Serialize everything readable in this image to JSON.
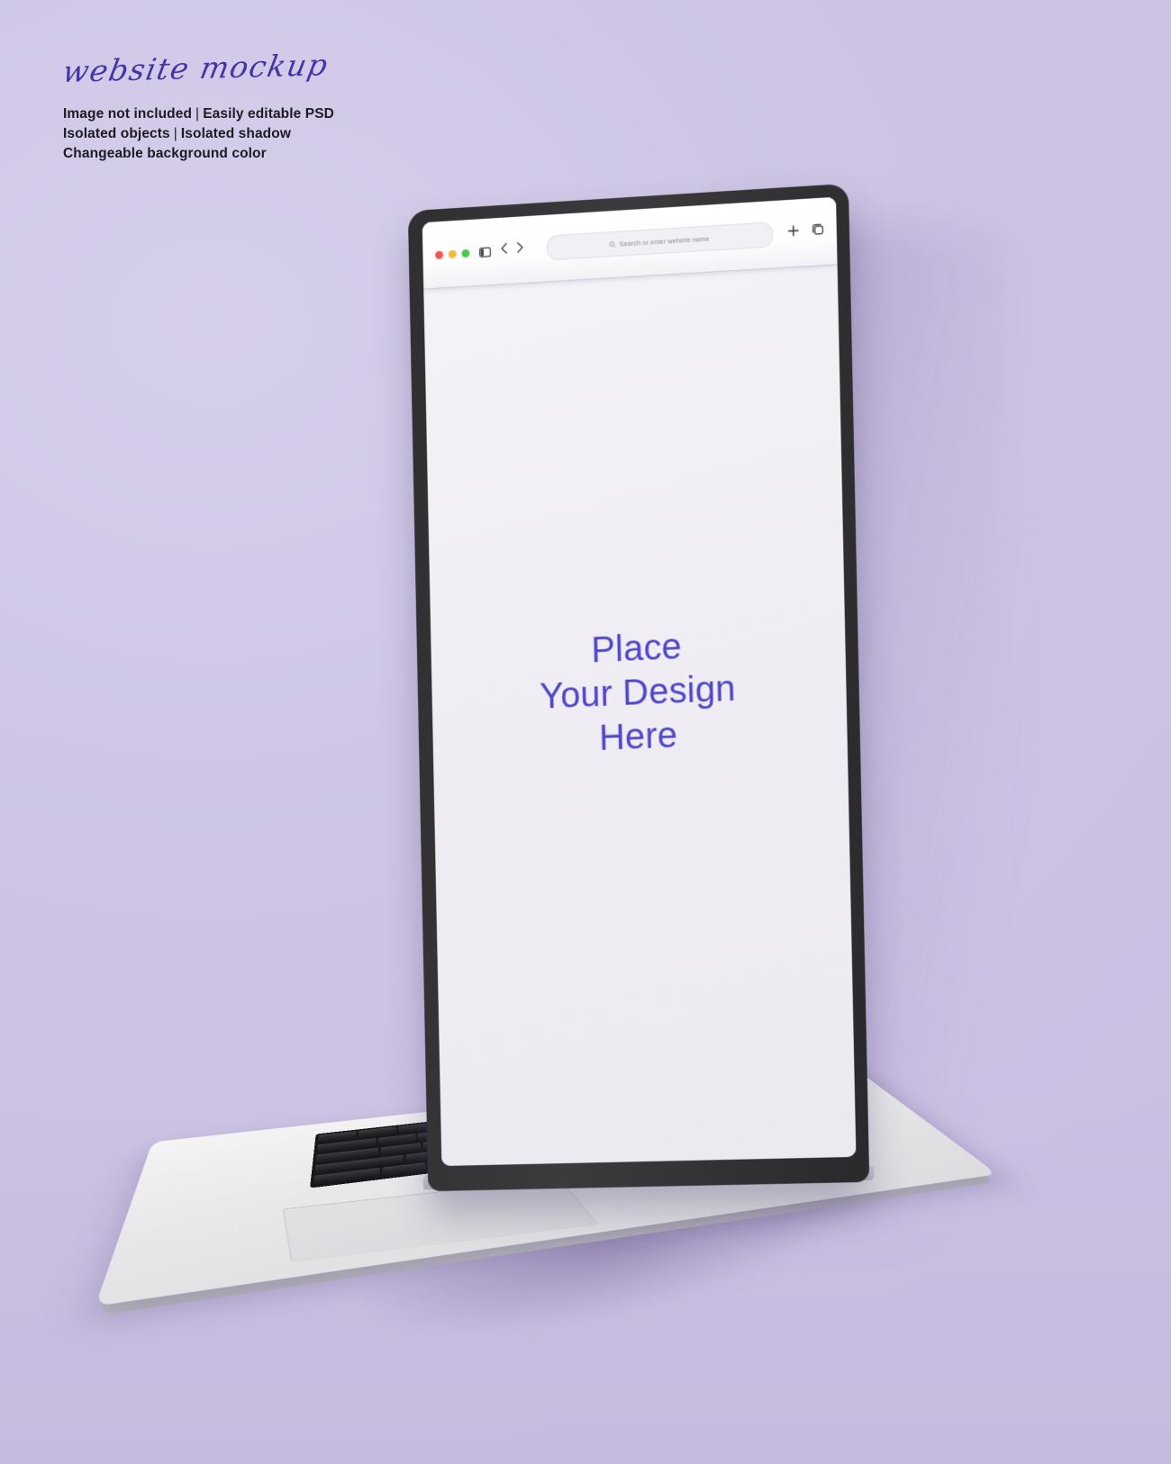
{
  "background": {
    "color": "#cfc6e6",
    "accent_text_color": "#4335a8",
    "design_text_color": "#4f46c8"
  },
  "caption": {
    "script_title": "website mockup",
    "line1_a": "Image not included",
    "line1_b": "Easily editable PSD",
    "line2_a": "Isolated objects",
    "line2_b": "Isolated shadow",
    "line3": "Changeable background color",
    "separator": "|"
  },
  "browser": {
    "traffic_lights": [
      {
        "name": "close",
        "color": "#f2564b"
      },
      {
        "name": "minimize",
        "color": "#f5b93a"
      },
      {
        "name": "maximize",
        "color": "#4fc64c"
      }
    ],
    "sidebar_toggle_icon": "sidebar-icon",
    "back_icon": "chevron-left-icon",
    "forward_icon": "chevron-right-icon",
    "search_icon": "search-icon",
    "address_placeholder": "Search or enter website name",
    "address_value": "",
    "new_tab_icon": "plus-icon",
    "tab_overview_icon": "copy-tabs-icon"
  },
  "screen": {
    "placeholder_line1": "Place",
    "placeholder_line2": "Your Design",
    "placeholder_line3": "Here"
  },
  "device": {
    "type": "laptop",
    "bezel_color": "#333336",
    "body_color": "#e8e8ea",
    "keyboard_color": "#17171a",
    "trackpad_label": "trackpad"
  }
}
